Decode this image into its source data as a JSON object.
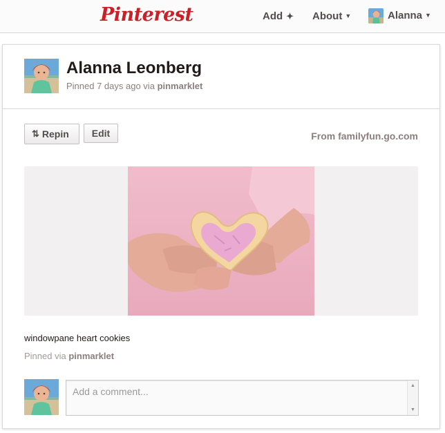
{
  "header": {
    "logo": "Pinterest",
    "nav": {
      "add_label": "Add",
      "add_icon": "plus-icon",
      "about_label": "About",
      "user_label": "Alanna"
    }
  },
  "pin": {
    "pinner_name": "Alanna Leonberg",
    "meta_prefix": "Pinned 7 days ago via",
    "meta_source": "pinmarklet",
    "actions": {
      "repin_label": "Repin",
      "edit_label": "Edit"
    },
    "source_text": "From familyfun.go.com",
    "description": "windowpane heart cookies",
    "pinned_via_prefix": "Pinned via",
    "pinned_via_source": "pinmarklet"
  },
  "comment": {
    "placeholder": "Add a comment..."
  },
  "colors": {
    "brand": "#cb2027",
    "muted_text": "#8c7e7e",
    "image_bg": "#f2f0f0"
  }
}
